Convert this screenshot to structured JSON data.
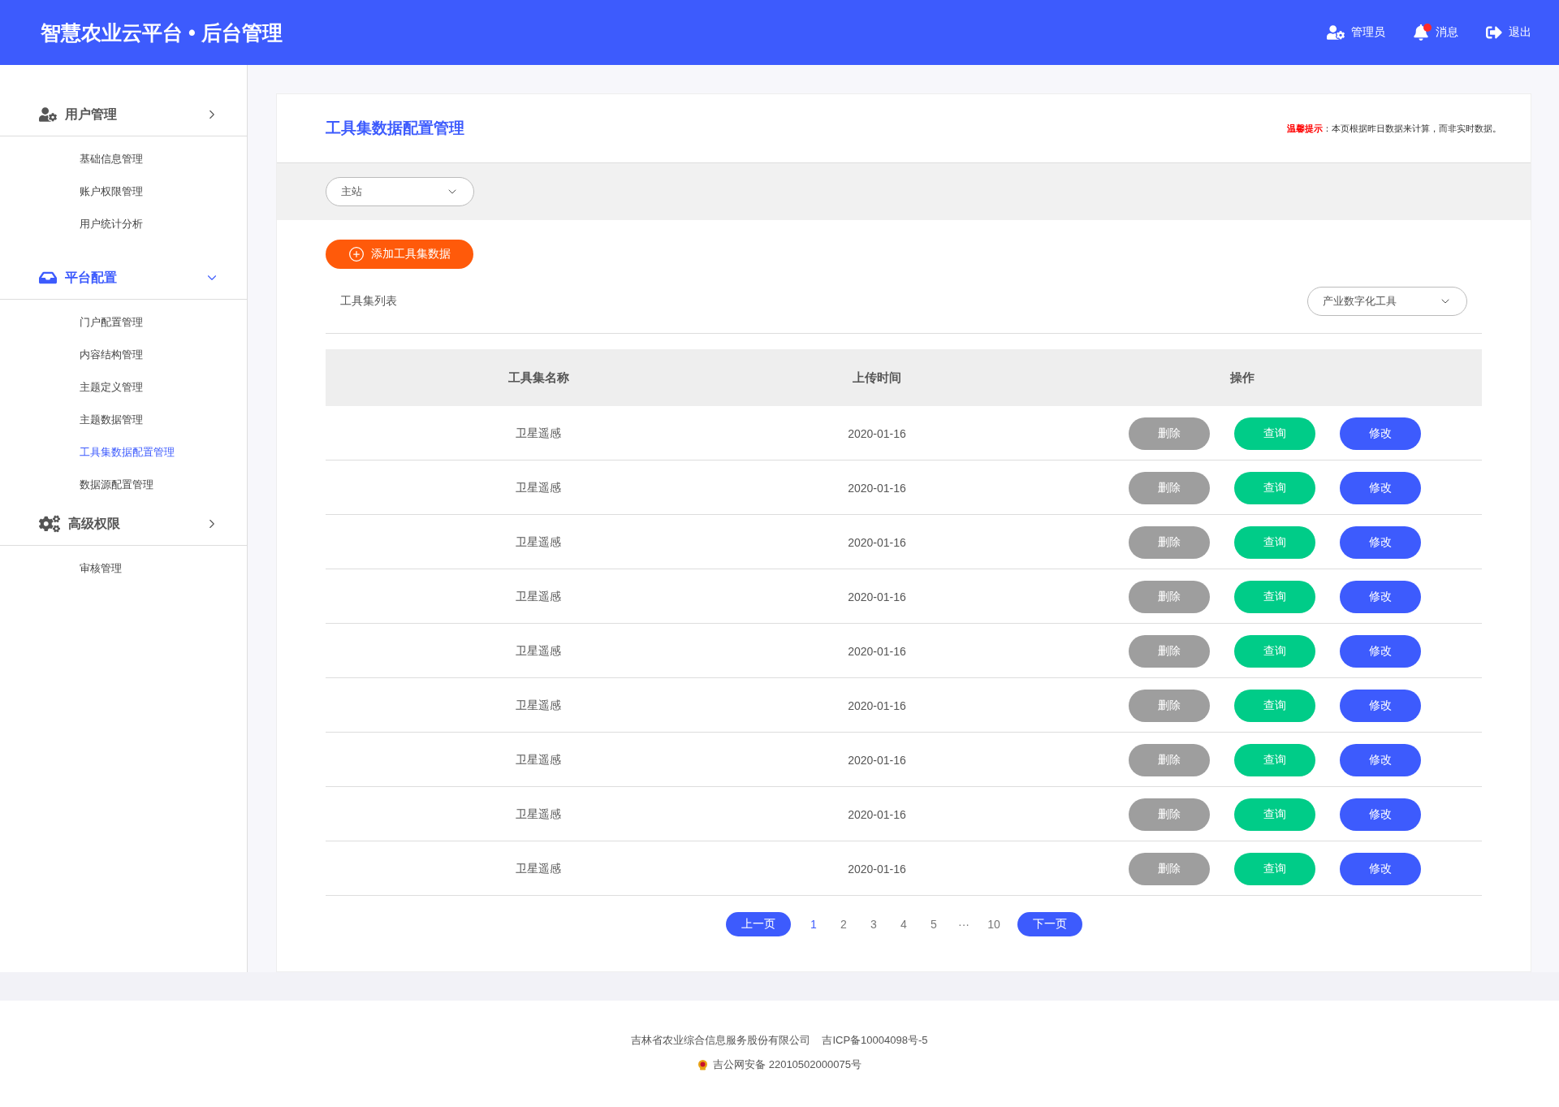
{
  "header": {
    "title": "智慧农业云平台 • 后台管理",
    "actions": [
      {
        "kind": "admin",
        "label": "管理员",
        "unread": false
      },
      {
        "kind": "messages",
        "label": "消息",
        "unread": true
      },
      {
        "kind": "logout",
        "label": "退出",
        "unread": false
      }
    ]
  },
  "sidebar": {
    "groups": [
      {
        "kind": "users",
        "title": "用户管理",
        "expanded": false,
        "items": [
          {
            "label": "基础信息管理",
            "selected": false
          },
          {
            "label": "账户权限管理",
            "selected": false
          },
          {
            "label": "用户统计分析",
            "selected": false
          }
        ]
      },
      {
        "kind": "platform",
        "title": "平台配置",
        "expanded": true,
        "items": [
          {
            "label": "门户配置管理",
            "selected": false
          },
          {
            "label": "内容结构管理",
            "selected": false
          },
          {
            "label": "主题定义管理",
            "selected": false
          },
          {
            "label": "主题数据管理",
            "selected": false
          },
          {
            "label": "工具集数据配置管理",
            "selected": true
          },
          {
            "label": "数据源配置管理",
            "selected": false
          }
        ]
      },
      {
        "kind": "advanced",
        "title": "高级权限",
        "expanded": false,
        "items": [
          {
            "label": "审核管理",
            "selected": false
          }
        ]
      }
    ]
  },
  "page": {
    "title": "工具集数据配置管理",
    "notice": {
      "label": "温馨提示",
      "text": "：本页根据昨日数据来计算，而非实时数据。"
    },
    "site_select": {
      "value": "主站"
    },
    "add_button": "添加工具集数据",
    "list_title": "工具集列表",
    "category_select": {
      "value": "产业数字化工具"
    }
  },
  "table": {
    "columns": [
      "工具集名称",
      "上传时间",
      "操作"
    ],
    "rows": [
      {
        "name": "卫星遥感",
        "date": "2020-01-16",
        "actions": [
          {
            "kind": "delete",
            "label": "删除"
          },
          {
            "kind": "query",
            "label": "查询"
          },
          {
            "kind": "edit",
            "label": "修改"
          }
        ]
      },
      {
        "name": "卫星遥感",
        "date": "2020-01-16",
        "actions": [
          {
            "kind": "delete",
            "label": "删除"
          },
          {
            "kind": "query",
            "label": "查询"
          },
          {
            "kind": "edit",
            "label": "修改"
          }
        ]
      },
      {
        "name": "卫星遥感",
        "date": "2020-01-16",
        "actions": [
          {
            "kind": "delete",
            "label": "删除"
          },
          {
            "kind": "query",
            "label": "查询"
          },
          {
            "kind": "edit",
            "label": "修改"
          }
        ]
      },
      {
        "name": "卫星遥感",
        "date": "2020-01-16",
        "actions": [
          {
            "kind": "delete",
            "label": "删除"
          },
          {
            "kind": "query",
            "label": "查询"
          },
          {
            "kind": "edit",
            "label": "修改"
          }
        ]
      },
      {
        "name": "卫星遥感",
        "date": "2020-01-16",
        "actions": [
          {
            "kind": "delete",
            "label": "删除"
          },
          {
            "kind": "query",
            "label": "查询"
          },
          {
            "kind": "edit",
            "label": "修改"
          }
        ]
      },
      {
        "name": "卫星遥感",
        "date": "2020-01-16",
        "actions": [
          {
            "kind": "delete",
            "label": "删除"
          },
          {
            "kind": "query",
            "label": "查询"
          },
          {
            "kind": "edit",
            "label": "修改"
          }
        ]
      },
      {
        "name": "卫星遥感",
        "date": "2020-01-16",
        "actions": [
          {
            "kind": "delete",
            "label": "删除"
          },
          {
            "kind": "query",
            "label": "查询"
          },
          {
            "kind": "edit",
            "label": "修改"
          }
        ]
      },
      {
        "name": "卫星遥感",
        "date": "2020-01-16",
        "actions": [
          {
            "kind": "delete",
            "label": "删除"
          },
          {
            "kind": "query",
            "label": "查询"
          },
          {
            "kind": "edit",
            "label": "修改"
          }
        ]
      },
      {
        "name": "卫星遥感",
        "date": "2020-01-16",
        "actions": [
          {
            "kind": "delete",
            "label": "删除"
          },
          {
            "kind": "query",
            "label": "查询"
          },
          {
            "kind": "edit",
            "label": "修改"
          }
        ]
      }
    ]
  },
  "pagination": {
    "prev": "上一页",
    "pages": [
      {
        "label": "1",
        "selected": true
      },
      {
        "label": "2",
        "selected": false
      },
      {
        "label": "3",
        "selected": false
      },
      {
        "label": "4",
        "selected": false
      },
      {
        "label": "5",
        "selected": false
      },
      {
        "label": "···",
        "selected": false
      },
      {
        "label": "10",
        "selected": false
      }
    ],
    "next": "下一页"
  },
  "footer": {
    "company": "吉林省农业综合信息服务股份有限公司",
    "icp": "吉ICP备10004098号-5",
    "police": "吉公网安备 22010502000075号"
  }
}
